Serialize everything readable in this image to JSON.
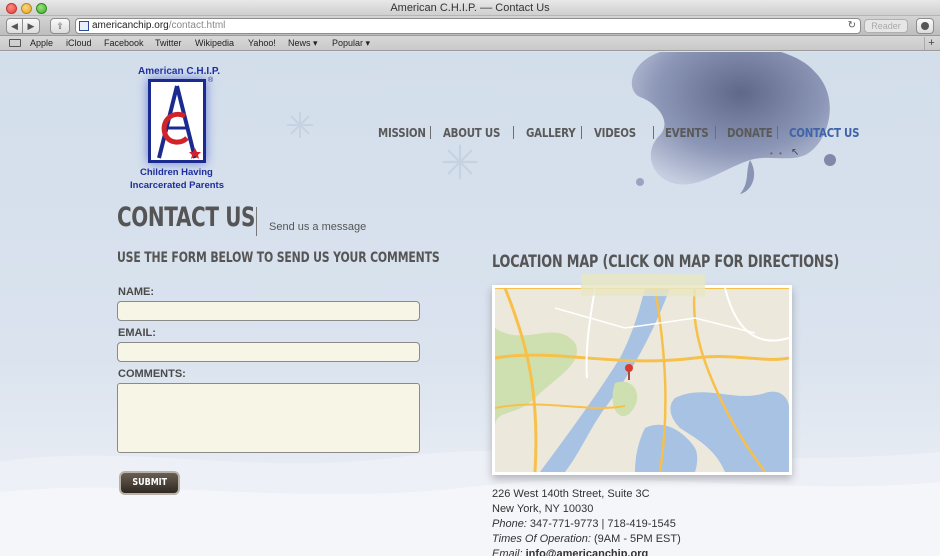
{
  "browser": {
    "window_title": "American C.H.I.P. –– Contact Us",
    "url_domain": "americanchip.org",
    "url_path": "/contact.html",
    "reader_label": "Reader",
    "bookmarks": [
      "Apple",
      "iCloud",
      "Facebook",
      "Twitter",
      "Wikipedia",
      "Yahoo!",
      "News ▾",
      "Popular ▾"
    ]
  },
  "logo": {
    "top_text": "American C.H.I.P.",
    "registered": "®",
    "line1": "Children Having",
    "line2": "Incarcerated Parents"
  },
  "nav": {
    "items": [
      "MISSION",
      "ABOUT US",
      "GALLERY",
      "VIDEOS",
      "EVENTS",
      "DONATE",
      "CONTACT US"
    ],
    "active": "CONTACT US"
  },
  "header": {
    "title": "CONTACT US",
    "subtitle": "Send us a message"
  },
  "form": {
    "heading": "USE THE FORM BELOW TO SEND US YOUR COMMENTS",
    "name_label": "NAME:",
    "email_label": "EMAIL:",
    "comments_label": "COMMENTS:",
    "name_value": "",
    "email_value": "",
    "comments_value": "",
    "submit_label": "SUBMIT"
  },
  "map": {
    "heading": "LOCATION MAP (CLICK ON MAP FOR DIRECTIONS)"
  },
  "address": {
    "line1": "226 West 140th Street, Suite 3C",
    "line2": "New York, NY 10030",
    "phone_label": "Phone:",
    "phone_value": " 347-771-9773 | 718-419-1545",
    "hours_label": "Times Of Operation:",
    "hours_value": " (9AM - 5PM EST)",
    "email_label": "Email:",
    "email_value": "info@americanchip.org"
  },
  "colors": {
    "accent": "#3f64a8",
    "nav_text": "#5a5a5a",
    "input_bg": "#f7f6e6",
    "button_bg": "#3d342c"
  }
}
